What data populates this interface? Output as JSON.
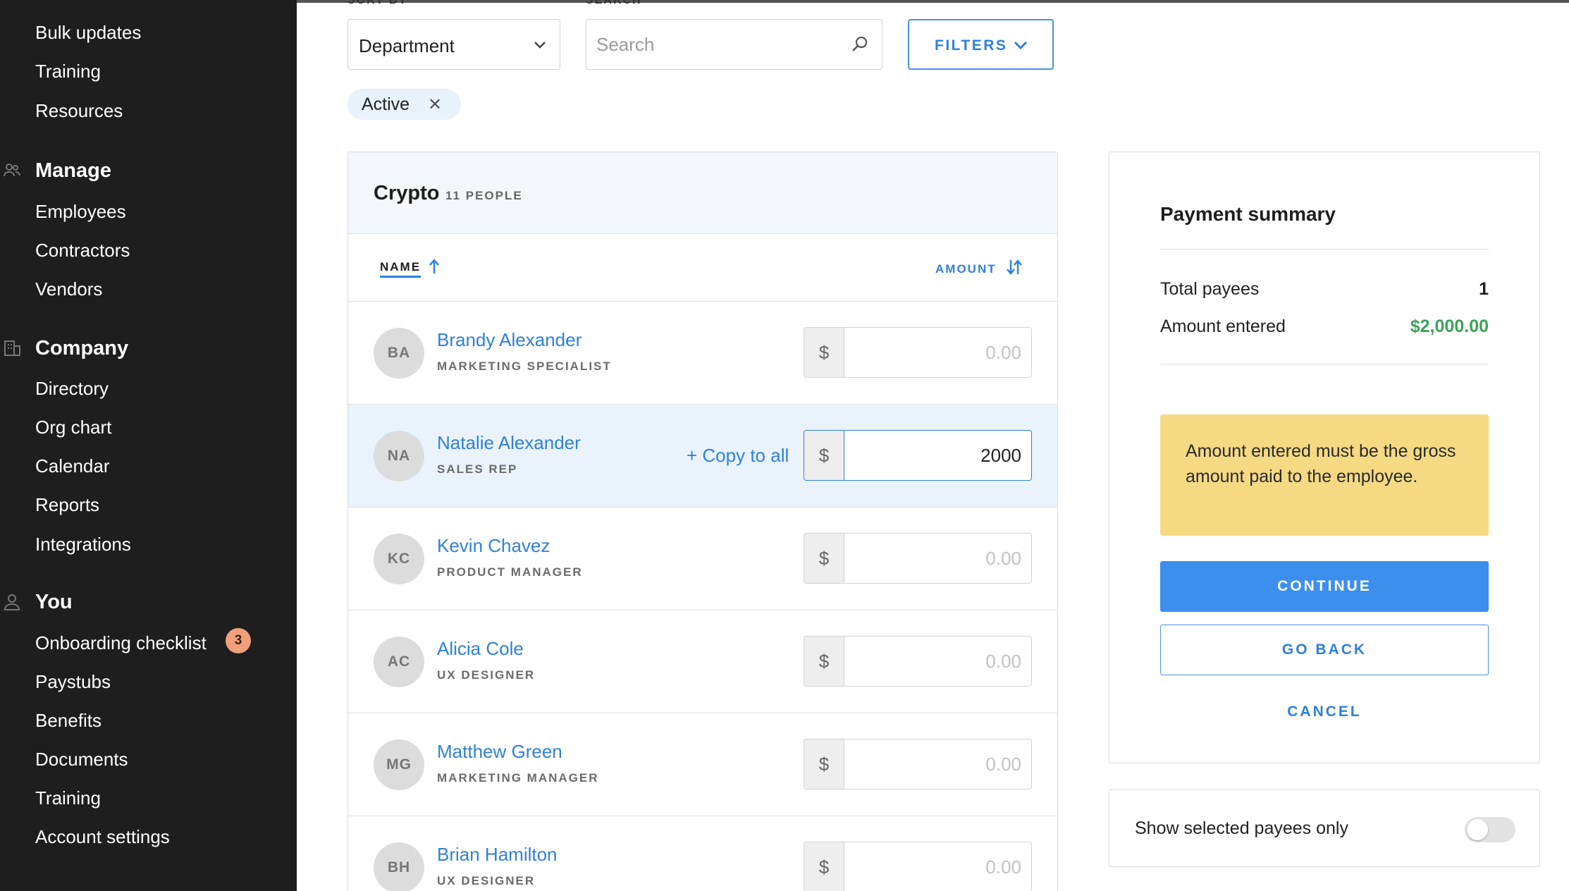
{
  "sidebar": {
    "top_items": [
      "Bulk updates",
      "Training",
      "Resources"
    ],
    "manage": {
      "title": "Manage",
      "icon": "people-icon",
      "items": [
        "Employees",
        "Contractors",
        "Vendors"
      ]
    },
    "company": {
      "title": "Company",
      "icon": "building-icon",
      "items": [
        "Directory",
        "Org chart",
        "Calendar",
        "Reports",
        "Integrations"
      ]
    },
    "you": {
      "title": "You",
      "icon": "person-icon",
      "items": [
        "Onboarding checklist",
        "Paystubs",
        "Benefits",
        "Documents",
        "Training",
        "Account settings"
      ],
      "badge": "3"
    }
  },
  "controls": {
    "sort_label": "SORT BY",
    "sort_value": "Department",
    "search_label": "SEARCH",
    "search_placeholder": "Search",
    "filters_label": "FILTERS",
    "chip_label": "Active",
    "chip_close": "✕"
  },
  "table": {
    "group_title": "Crypto",
    "group_count": "11 PEOPLE",
    "col_name": "NAME",
    "col_amount": "AMOUNT",
    "currency": "$",
    "amount_placeholder": "0.00",
    "copy_all": "+ Copy to all",
    "rows": [
      {
        "initials": "BA",
        "name": "Brandy Alexander",
        "role": "MARKETING SPECIALIST",
        "amount": ""
      },
      {
        "initials": "NA",
        "name": "Natalie Alexander",
        "role": "SALES REP",
        "amount": "2000"
      },
      {
        "initials": "KC",
        "name": "Kevin Chavez",
        "role": "PRODUCT MANAGER",
        "amount": ""
      },
      {
        "initials": "AC",
        "name": "Alicia Cole",
        "role": "UX DESIGNER",
        "amount": ""
      },
      {
        "initials": "MG",
        "name": "Matthew Green",
        "role": "MARKETING MANAGER",
        "amount": ""
      },
      {
        "initials": "BH",
        "name": "Brian Hamilton",
        "role": "UX DESIGNER",
        "amount": ""
      }
    ]
  },
  "summary": {
    "title": "Payment summary",
    "total_payees_label": "Total payees",
    "total_payees_value": "1",
    "amount_entered_label": "Amount entered",
    "amount_entered_value": "$2,000.00",
    "notice": "Amount entered must be the gross amount paid to the employee.",
    "continue_label": "CONTINUE",
    "go_back_label": "GO BACK",
    "cancel_label": "CANCEL",
    "toggle_label": "Show selected payees only",
    "toggle_on": false
  },
  "colors": {
    "accent": "#2f80d8",
    "primary_button": "#3d8fee",
    "success": "#3aa45a",
    "notice_bg": "#f6d983",
    "badge": "#f2a07b",
    "sidebar_bg": "#1e1e1e"
  }
}
